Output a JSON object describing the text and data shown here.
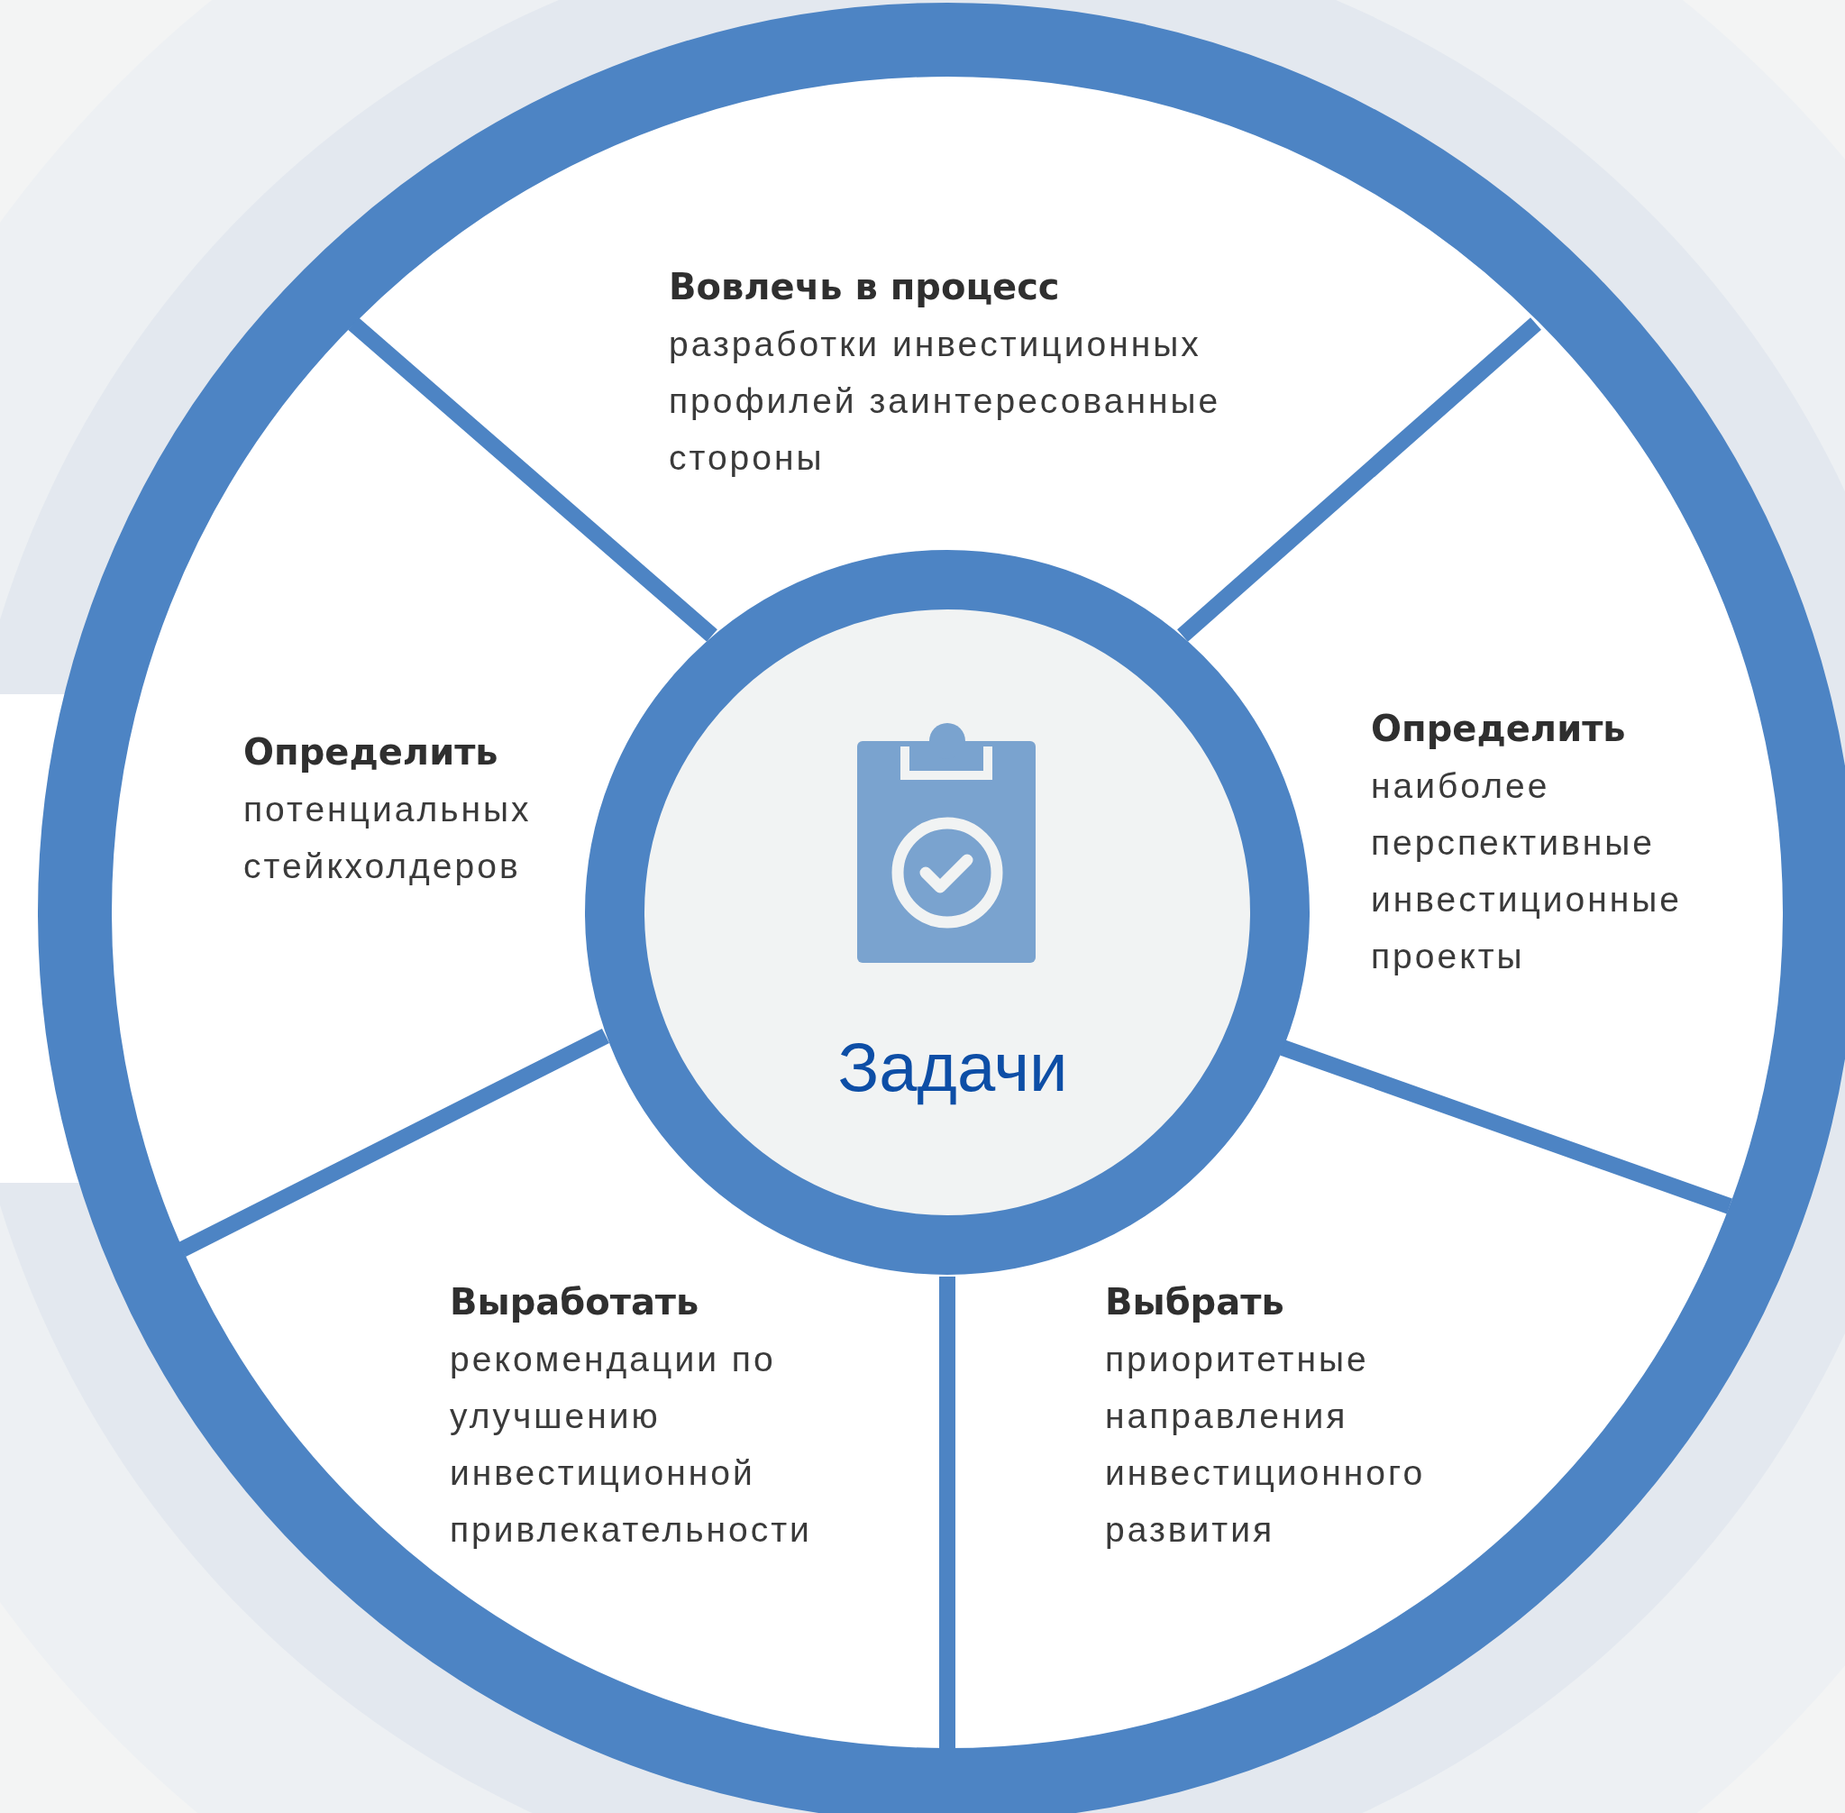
{
  "center": {
    "title": "Задачи"
  },
  "segments": [
    {
      "kind": "top",
      "title": "Вовлечь в процесс",
      "text": "разработки инвестиционных профилей заинтересованные стороны"
    },
    {
      "kind": "left",
      "title": "Определить",
      "text": "потенциальных стейкхолдеров"
    },
    {
      "kind": "right",
      "title": "Определить",
      "text": "наиболее перспективные инвестиционные проекты"
    },
    {
      "kind": "bottom-left",
      "title": "Выработать",
      "text": "рекомендации по улучшению инвестиционной привлекательности"
    },
    {
      "kind": "bottom-right",
      "title": "Выбрать",
      "text": "приоритетные направления инвестиционного развития"
    }
  ]
}
